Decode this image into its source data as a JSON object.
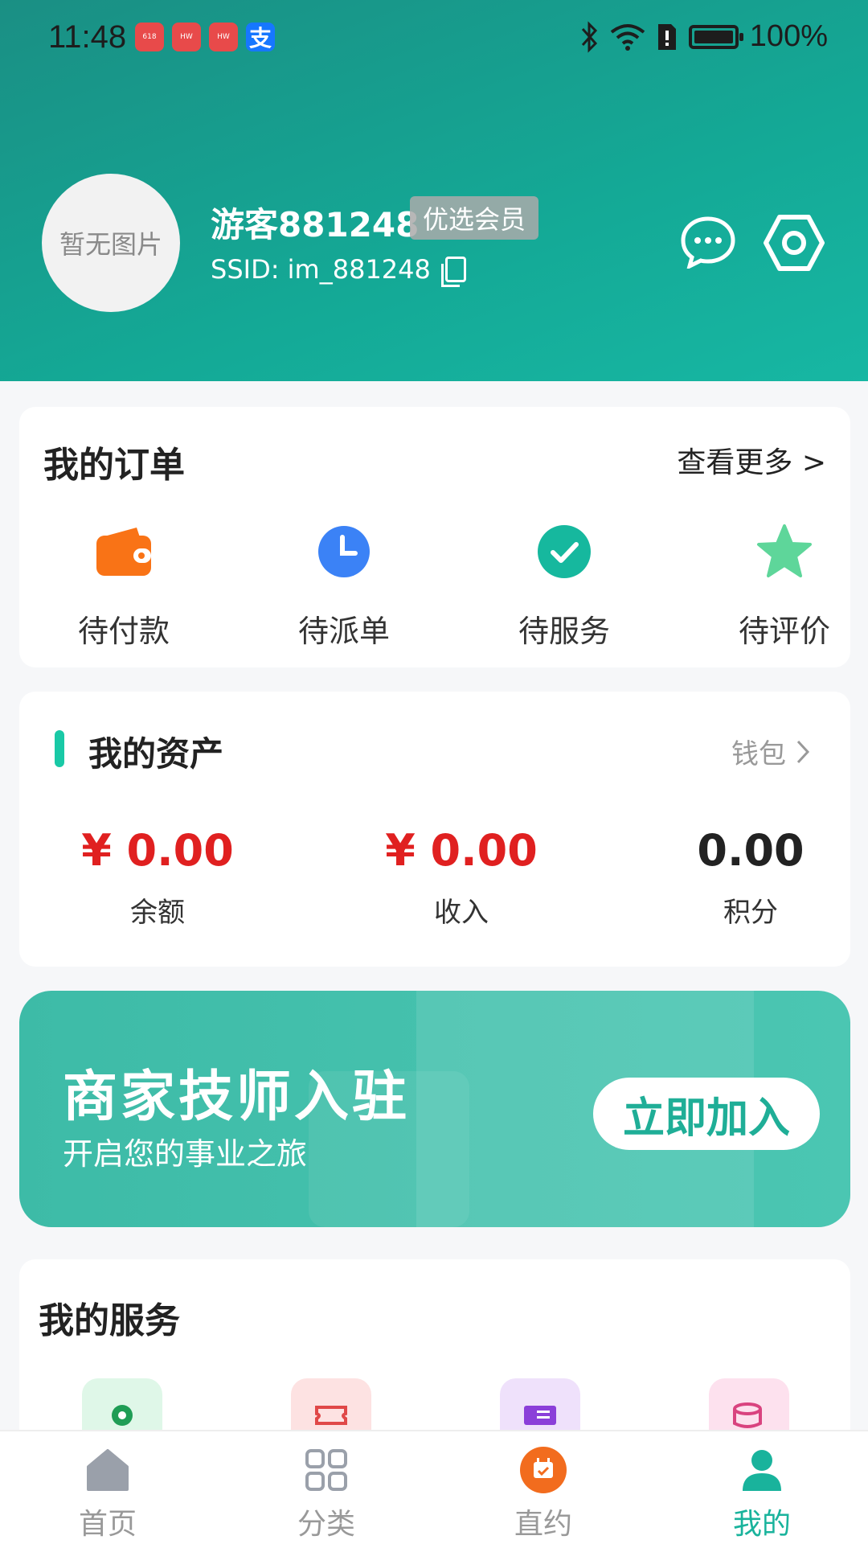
{
  "status_bar": {
    "time": "11:48",
    "battery": "100%"
  },
  "profile": {
    "avatar_placeholder": "暂无图片",
    "username": "游客881248",
    "member_badge": "优选会员",
    "ssid": "SSID: im_881248"
  },
  "orders": {
    "title": "我的订单",
    "more": "查看更多 >",
    "items": [
      {
        "label": "待付款",
        "icon": "wallet-icon",
        "color": "#f97316"
      },
      {
        "label": "待派单",
        "icon": "clock-icon",
        "color": "#3b82f6"
      },
      {
        "label": "待服务",
        "icon": "check-circle-icon",
        "color": "#16b89e"
      },
      {
        "label": "待评价",
        "icon": "star-icon",
        "color": "#5ed69a"
      }
    ]
  },
  "assets": {
    "title": "我的资产",
    "wallet": "钱包",
    "items": [
      {
        "value": "¥ 0.00",
        "label": "余额"
      },
      {
        "value": "¥ 0.00",
        "label": "收入"
      },
      {
        "value": "0.00",
        "label": "积分"
      }
    ]
  },
  "banner": {
    "title": "商家技师入驻",
    "subtitle": "开启您的事业之旅",
    "button": "立即加入"
  },
  "services": {
    "title": "我的服务",
    "icons": [
      {
        "icon": "location-icon",
        "bg": "#dff7e8",
        "fg": "#1f9d55"
      },
      {
        "icon": "ticket-icon",
        "bg": "#fde2e2",
        "fg": "#e04848"
      },
      {
        "icon": "list-icon",
        "bg": "#efe1fb",
        "fg": "#8b3fd9"
      },
      {
        "icon": "database-icon",
        "bg": "#fde1ee",
        "fg": "#d9437f"
      }
    ]
  },
  "nav": {
    "items": [
      {
        "label": "首页",
        "icon": "home-icon"
      },
      {
        "label": "分类",
        "icon": "grid-icon"
      },
      {
        "label": "直约",
        "icon": "calendar-icon"
      },
      {
        "label": "我的",
        "icon": "user-icon",
        "active": true
      }
    ]
  },
  "colors": {
    "brand": "#14a996",
    "price_red": "#e02020",
    "nav_active": "#19b39c"
  }
}
